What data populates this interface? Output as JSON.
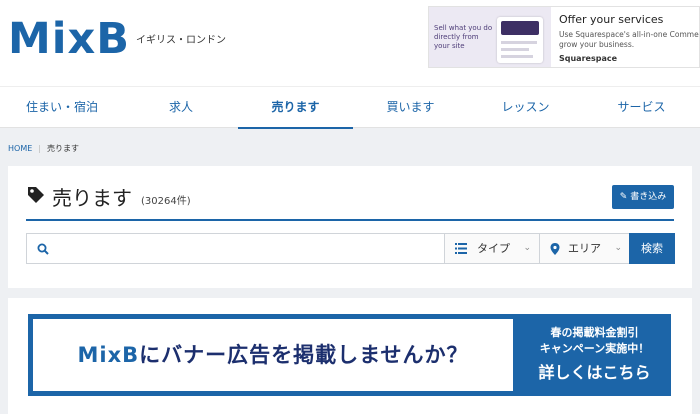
{
  "header": {
    "logo": "MixB",
    "locale": "イギリス・ロンドン"
  },
  "ad": {
    "image_text": "Sell what you do directly from your site",
    "title": "Offer your services",
    "subtitle_line1": "Use Squarespace's all-in-one Commerce",
    "subtitle_line2": "grow your business.",
    "brand": "Squarespace"
  },
  "nav": {
    "items": [
      {
        "label": "住まい・宿泊"
      },
      {
        "label": "求人"
      },
      {
        "label": "売ります"
      },
      {
        "label": "買います"
      },
      {
        "label": "レッスン"
      },
      {
        "label": "サービス"
      }
    ],
    "active_index": 2
  },
  "breadcrumb": {
    "home": "HOME",
    "current": "売ります"
  },
  "main": {
    "title": "売ります",
    "count": "(30264件)",
    "post_button": "書き込み"
  },
  "search": {
    "placeholder": "",
    "type_label": "タイプ",
    "area_label": "エリア",
    "button": "検索"
  },
  "banner": {
    "brand": "MixB",
    "text": "にバナー広告を掲載しませんか？",
    "right_line1": "春の掲載料金割引",
    "right_line2": "キャンペーン実施中！",
    "right_line3": "詳しくはこちら"
  },
  "colors": {
    "brand_blue": "#1c65a8",
    "page_bg": "#eef0f3"
  }
}
